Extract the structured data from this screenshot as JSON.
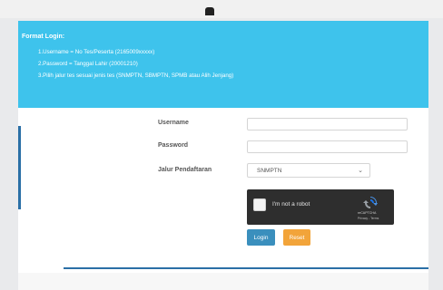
{
  "info": {
    "title": "Format Login:",
    "lines": [
      "1.Username = No Tes/Peserta (2165009xxxxx)",
      "2.Password = Tanggal Lahir (20001210)",
      "3.Pilih jalur tes sesuai jenis tes (SNMPTN, SBMPTN, SPMB atau Alih Jenjang)"
    ]
  },
  "form": {
    "username_label": "Username",
    "username_value": "",
    "password_label": "Password",
    "password_value": "",
    "jalur_label": "Jalur Pendaftaran",
    "jalur_selected": "SNMPTN",
    "chevron": "⌄"
  },
  "captcha": {
    "label": "I'm not a robot",
    "brand": "reCAPTCHA",
    "terms": "Privacy - Terms",
    "icon": "recaptcha-logo"
  },
  "buttons": {
    "login": "Login",
    "reset": "Reset"
  },
  "colors": {
    "info_bg": "#3ec3ec",
    "login_button": "#3a8fbd",
    "reset_button": "#f2a43a",
    "divider": "#2a6fa6"
  }
}
